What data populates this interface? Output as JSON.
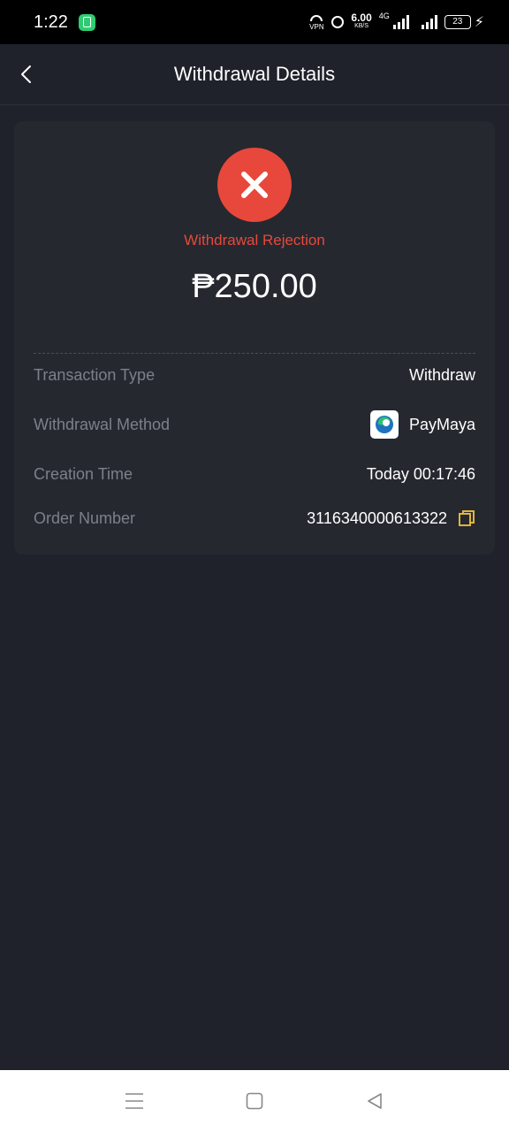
{
  "status_bar": {
    "time": "1:22",
    "vpn_label": "VPN",
    "net_speed_value": "6.00",
    "net_speed_unit": "KB/S",
    "net_type": "4G",
    "battery": "23"
  },
  "header": {
    "title": "Withdrawal Details"
  },
  "card": {
    "status_label": "Withdrawal Rejection",
    "amount": "₱250.00",
    "status_color": "#e8483b",
    "rows": [
      {
        "label": "Transaction Type",
        "value": "Withdraw"
      },
      {
        "label": "Withdrawal Method",
        "value": "PayMaya"
      },
      {
        "label": "Creation Time",
        "value": "Today 00:17:46"
      },
      {
        "label": "Order Number",
        "value": "3116340000613322"
      }
    ]
  },
  "icons": {
    "back": "chevron-left-icon",
    "status": "close-icon",
    "method": "paymaya-logo-icon",
    "copy": "copy-icon",
    "nav_menu": "menu-icon",
    "nav_home": "home-square-icon",
    "nav_back": "triangle-back-icon"
  },
  "colors": {
    "background": "#1f222a",
    "card": "#25282f",
    "accent_copy": "#e2b33c"
  }
}
